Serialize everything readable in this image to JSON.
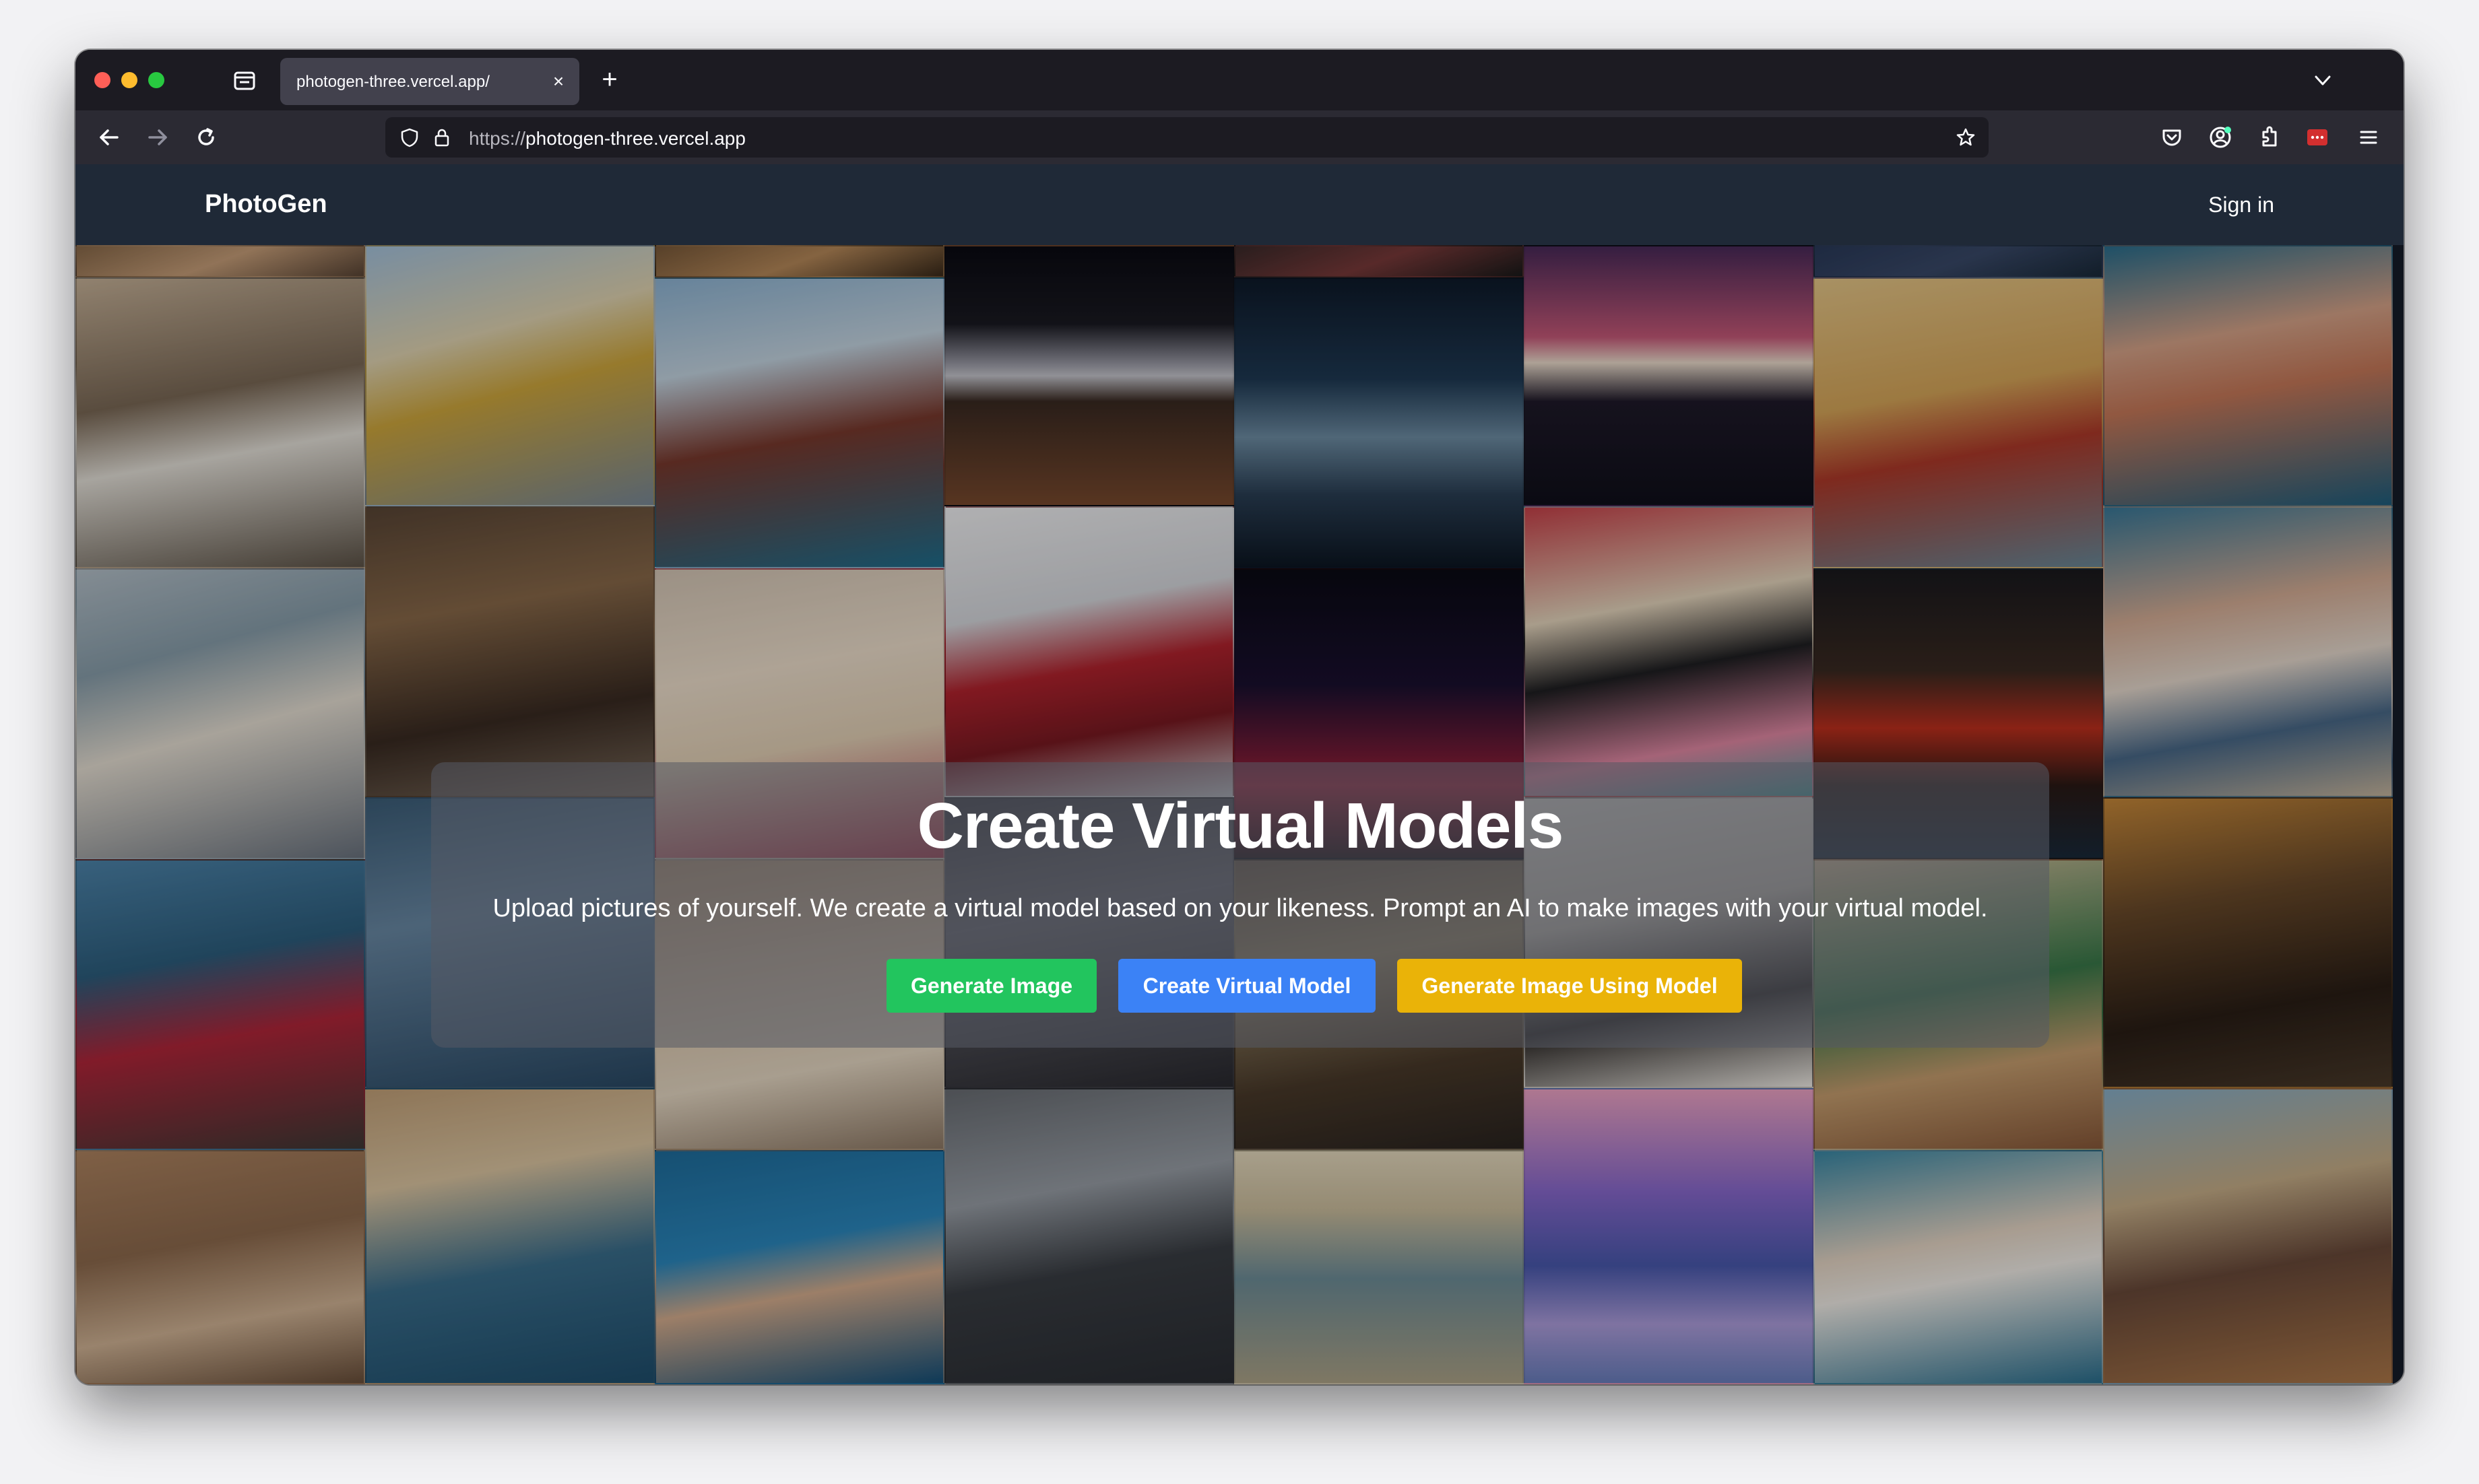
{
  "browser": {
    "tab": {
      "title": "photogen-three.vercel.app/",
      "close_icon": "close-icon"
    },
    "new_tab_icon": "plus-icon",
    "url": {
      "scheme": "https://",
      "host": "photogen-three.vercel.app"
    }
  },
  "site": {
    "brand": "PhotoGen",
    "sign_in": "Sign in"
  },
  "hero": {
    "title": "Create Virtual Models",
    "subtitle": "Upload pictures of yourself. We create a virtual model based on your likeness. Prompt an AI to make images with your virtual model.",
    "buttons": {
      "generate_image": "Generate Image",
      "create_model": "Create Virtual Model",
      "generate_with_model": "Generate Image Using Model"
    }
  },
  "colors": {
    "header_bg": "#1f2937",
    "btn_green": "#22c55e",
    "btn_blue": "#3b82f6",
    "btn_yellow": "#eab308"
  }
}
